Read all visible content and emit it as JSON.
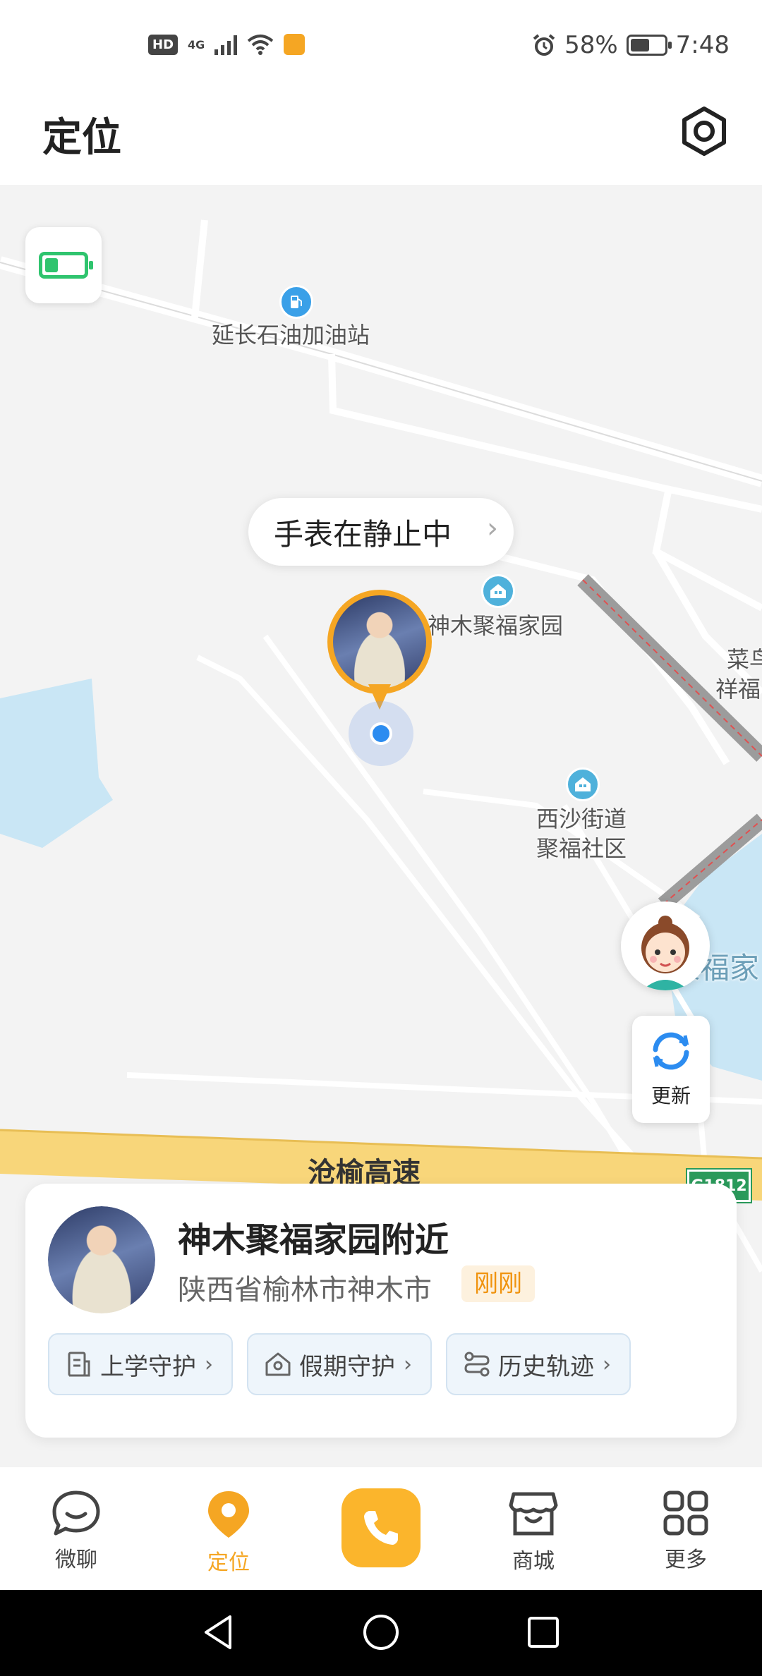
{
  "status_bar": {
    "network_badge": "HD",
    "network_type": "4G",
    "battery_percent": "58%",
    "battery_level": 0.58,
    "time": "7:48"
  },
  "header": {
    "title": "定位",
    "settings_icon": "gear-icon"
  },
  "map": {
    "battery_level": 0.35,
    "poi": {
      "gas_station": "延长石油加油站",
      "community_1": "神木聚福家园",
      "community_2_line1": "西沙街道",
      "community_2_line2": "聚福社区",
      "edge_label_1": "菜鸟",
      "edge_label_2": "祥福",
      "edge_label_3": "聚福家"
    },
    "watch_status": "手表在静止中",
    "highway_name": "沧榆高速",
    "highway_shield": "G1812",
    "refresh_label": "更新",
    "accent_color": "#f5a623"
  },
  "info_card": {
    "location_title": "神木聚福家园附近",
    "address": "陕西省榆林市神木市",
    "time_badge": "刚刚",
    "actions": [
      {
        "label": "上学守护",
        "icon": "school-guard-icon"
      },
      {
        "label": "假期守护",
        "icon": "home-guard-icon"
      },
      {
        "label": "历史轨迹",
        "icon": "route-icon"
      }
    ]
  },
  "bottom_nav": {
    "items": [
      {
        "label": "微聊",
        "icon": "chat-icon"
      },
      {
        "label": "定位",
        "icon": "location-pin-icon"
      },
      {
        "label": "",
        "icon": "phone-icon"
      },
      {
        "label": "商城",
        "icon": "shop-icon"
      },
      {
        "label": "更多",
        "icon": "grid-icon"
      }
    ],
    "active_color": "#f5a623",
    "call_color": "#fbb52c"
  }
}
